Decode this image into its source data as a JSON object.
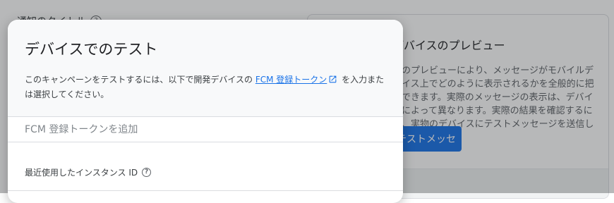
{
  "background": {
    "field_label": "通知のタイトル",
    "preview": {
      "title": "デバイスのプレビュー",
      "description": "このプレビューにより、メッセージがモバイルデバイス上でどのように表示されるかを全般的に把握できます。実際のメッセージの表示は、デバイスによって異なります。実際の結果を確認するには、実物のデバイスにテストメッセージを送信してください。",
      "send_button": "テストメッセージを送信"
    }
  },
  "dialog": {
    "title": "デバイスでのテスト",
    "desc_before": "このキャンペーンをテストするには、以下で開発デバイスの ",
    "desc_link": "FCM 登録トークン",
    "desc_after": " を入力または選択してください。",
    "token_placeholder": "FCM 登録トークンを追加",
    "recent_label": "最近使用したインスタンス ID",
    "help_glyph": "?",
    "colors": {
      "accent": "#1a73e8",
      "link": "#1a73e8"
    }
  }
}
